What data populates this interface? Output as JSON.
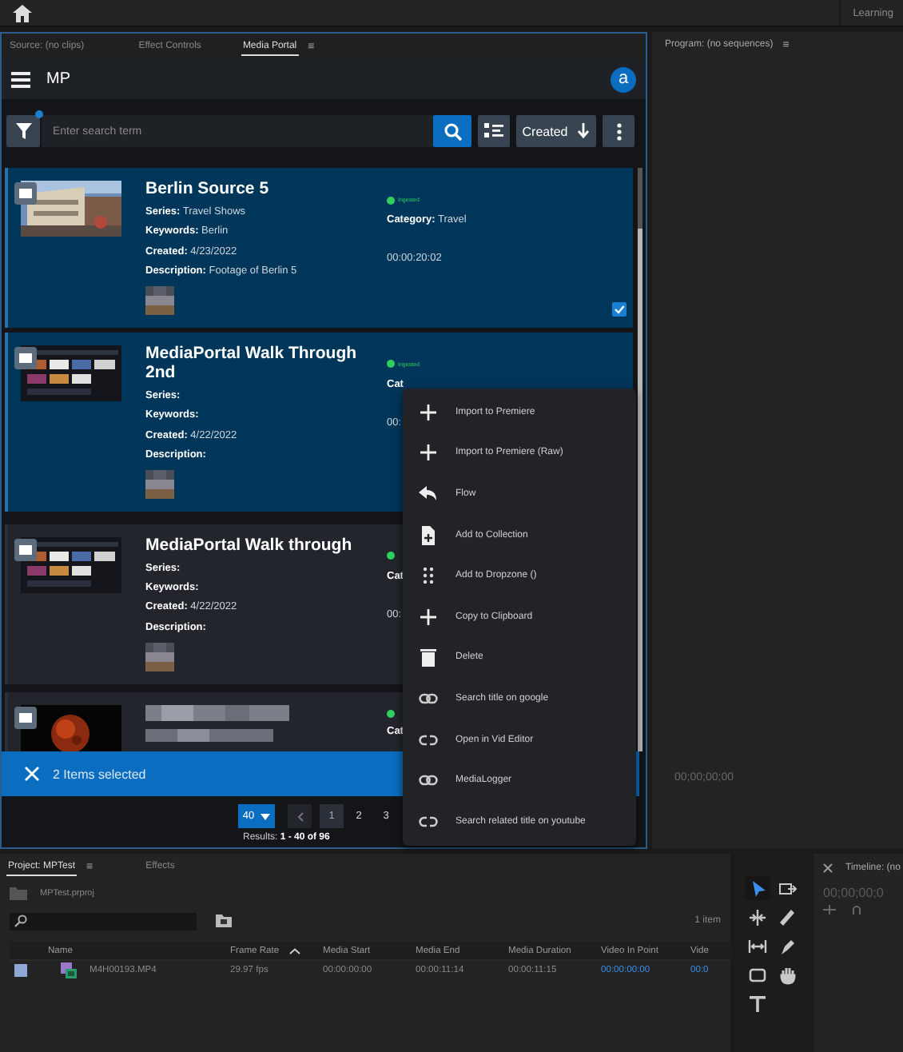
{
  "top_bar": {
    "workspace_tab": "Learning"
  },
  "source_panel": {
    "tabs": [
      {
        "label": "Source: (no clips)",
        "selected": false
      },
      {
        "label": "Effect Controls",
        "selected": false
      },
      {
        "label": "Media Portal",
        "selected": true,
        "menu": "≡"
      }
    ]
  },
  "portal": {
    "app_name": "MP",
    "avatar": "a",
    "filter_active": true,
    "search": {
      "placeholder": "Enter search term"
    },
    "sort": {
      "label": "Created"
    },
    "cards": [
      {
        "title": "Berlin Source 5",
        "selected": true,
        "checked": true,
        "fields": [
          {
            "label": "Series:",
            "value": "Travel Shows"
          },
          {
            "label": "Keywords:",
            "value": "Berlin"
          },
          {
            "label": "Created:",
            "value": "4/23/2022"
          },
          {
            "label": "Description:",
            "value": "Footage of Berlin 5"
          }
        ],
        "status": "Ingested",
        "category": {
          "label": "Category:",
          "value": "Travel"
        },
        "duration": "00:00:20:02"
      },
      {
        "title": "MediaPortal Walk Through 2nd",
        "selected": true,
        "fields": [
          {
            "label": "Series:"
          },
          {
            "label": "Keywords:"
          },
          {
            "label": "Created:",
            "value": "4/22/2022"
          },
          {
            "label": "Description:"
          }
        ],
        "status": "Ingested",
        "category": {
          "label": "Cat"
        },
        "duration": "00:"
      },
      {
        "title": "MediaPortal Walk through",
        "selected": false,
        "fields": [
          {
            "label": "Series:"
          },
          {
            "label": "Keywords:"
          },
          {
            "label": "Created:",
            "value": "4/22/2022"
          },
          {
            "label": "Description:"
          }
        ],
        "category": {
          "label": "Cat"
        },
        "duration": "00:"
      },
      {
        "selected": false,
        "category": {
          "label": "Cat"
        }
      }
    ],
    "selection_bar": {
      "text": "2 Items selected"
    },
    "pagination": {
      "page_size": "40",
      "pages": [
        {
          "label": "1",
          "selected": true
        },
        {
          "label": "2",
          "selected": false
        },
        {
          "label": "3",
          "selected": false
        }
      ],
      "results": "Results: **1 - 40 of 96**"
    }
  },
  "context_menu": {
    "items": [
      "Import to Premiere",
      "Import to Premiere (Raw)",
      "Flow",
      "Add to Collection",
      "Add to Dropzone ()",
      "Copy to Clipboard",
      "Delete",
      "Search title on google",
      "Open in Vid Editor",
      "MediaLogger",
      "Search related title on youtube"
    ]
  },
  "program_panel": {
    "tab": "Program: (no sequences)",
    "menu": "≡",
    "timecode": "00;00;00;00"
  },
  "project_panel": {
    "tabs": [
      {
        "label": "Project: MPTest",
        "selected": true,
        "menu": "≡"
      },
      {
        "label": "Effects",
        "selected": false
      }
    ],
    "path": "MPTest.prproj",
    "item_count": "1 item",
    "columns": [
      {
        "label": "Name",
        "sorted": false
      },
      {
        "label": "Frame Rate",
        "sorted": true
      },
      {
        "label": "Media Start",
        "sorted": false
      },
      {
        "label": "Media End",
        "sorted": false
      },
      {
        "label": "Media Duration",
        "sorted": false
      },
      {
        "label": "Video In Point",
        "sorted": false
      },
      {
        "label": "Vide",
        "sorted": false
      }
    ],
    "rows": [
      {
        "cells": [
          {
            "text": "M4H00193.MP4",
            "link": false
          },
          {
            "text": "29.97 fps",
            "link": false
          },
          {
            "text": "00:00:00:00",
            "link": false
          },
          {
            "text": "00:00:11:14",
            "link": false
          },
          {
            "text": "00:00:11:15",
            "link": false
          },
          {
            "text": "00:00:00:00",
            "link": true
          },
          {
            "text": "00:0",
            "link": true
          }
        ]
      }
    ]
  },
  "tools": [
    {
      "selected": true
    },
    {
      "selected": false
    },
    {
      "selected": false
    },
    {
      "selected": false
    },
    {
      "selected": false
    },
    {
      "selected": false
    },
    {
      "selected": false
    },
    {
      "selected": false
    },
    {
      "selected": false
    }
  ],
  "timeline_panel": {
    "tab": "Timeline: (no",
    "timecode": "00;00;00;0"
  }
}
